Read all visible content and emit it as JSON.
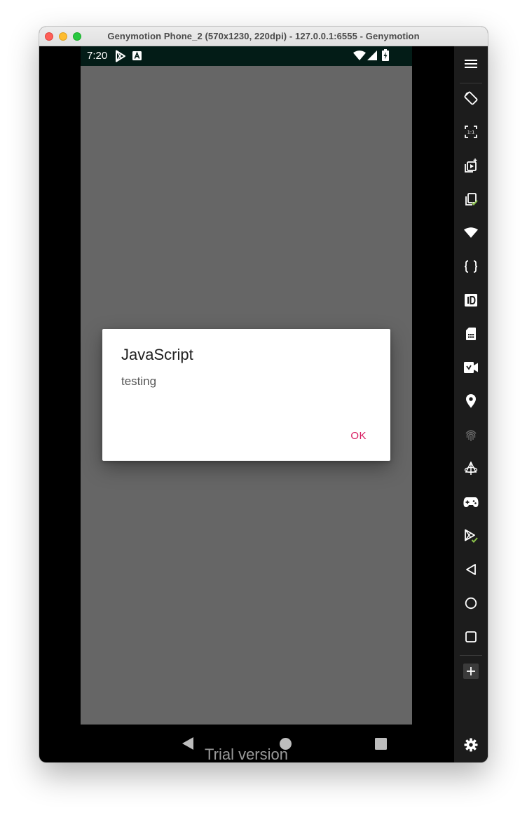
{
  "window": {
    "title": "Genymotion Phone_2 (570x1230, 220dpi) - 127.0.0.1:6555 - Genymotion"
  },
  "status_bar": {
    "time": "7:20",
    "icons": [
      "play-store-icon",
      "a-notification-icon",
      "wifi-icon",
      "signal-icon",
      "battery-charging-icon"
    ]
  },
  "dialog": {
    "title": "JavaScript",
    "message": "testing",
    "ok_label": "OK"
  },
  "nav_bar": {
    "watermark": "Trial version",
    "buttons": [
      "back-icon",
      "home-icon",
      "recents-icon"
    ]
  },
  "sidebar": {
    "tools": [
      "menu-icon",
      "rotate-icon",
      "pixel-perfect-icon",
      "capture-icon",
      "clipboard-icon",
      "wifi-icon",
      "braces-icon",
      "device-id-icon",
      "sim-card-icon",
      "camera-icon",
      "location-pin-icon",
      "fingerprint-icon",
      "motion-sensor-icon",
      "gamepad-icon",
      "gapps-icon",
      "back-icon",
      "home-icon",
      "recents-icon",
      "add-icon",
      "settings-icon"
    ]
  },
  "colors": {
    "status_bar": "#031c17",
    "screen_background": "#666666",
    "dialog_accent": "#d81b60",
    "sidebar": "#1c1c1c",
    "green_badge": "#8bc34a"
  }
}
